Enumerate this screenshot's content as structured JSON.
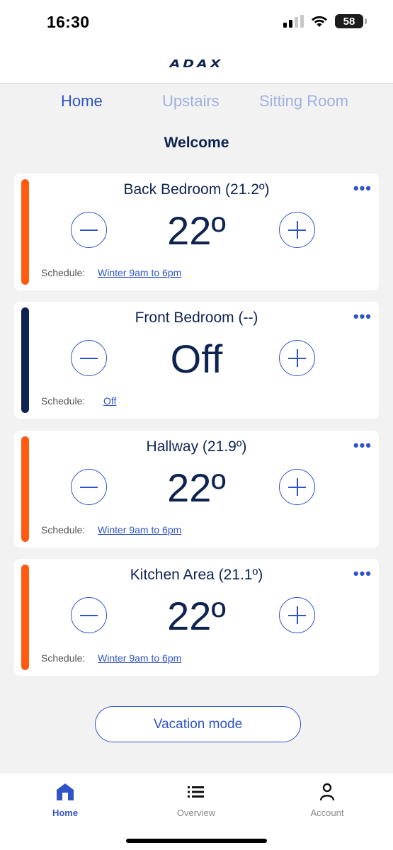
{
  "status": {
    "time": "16:30",
    "battery": "58"
  },
  "header": {
    "logo": "ADAX"
  },
  "tabs": [
    {
      "label": "Home",
      "active": true
    },
    {
      "label": "Upstairs",
      "active": false
    },
    {
      "label": "Sitting Room",
      "active": false
    }
  ],
  "welcome": "Welcome",
  "rooms": [
    {
      "title": "Back Bedroom (21.2º)",
      "setpoint": "22º",
      "schedule_label": "Schedule:",
      "schedule": "Winter 9am to 6pm",
      "bar_color": "#ff5a10"
    },
    {
      "title": "Front Bedroom (--)",
      "setpoint": "Off",
      "schedule_label": "Schedule:",
      "schedule": "Off",
      "bar_color": "#0f2350"
    },
    {
      "title": "Hallway (21.9º)",
      "setpoint": "22º",
      "schedule_label": "Schedule:",
      "schedule": "Winter 9am to 6pm",
      "bar_color": "#ff5a10"
    },
    {
      "title": "Kitchen Area (21.1º)",
      "setpoint": "22º",
      "schedule_label": "Schedule:",
      "schedule": "Winter 9am to 6pm",
      "bar_color": "#ff5a10"
    }
  ],
  "more_icon": "•••",
  "vacation_label": "Vacation mode",
  "nav": [
    {
      "label": "Home",
      "icon": "home-icon",
      "active": true
    },
    {
      "label": "Overview",
      "icon": "list-icon",
      "active": false
    },
    {
      "label": "Account",
      "icon": "person-icon",
      "active": false
    }
  ],
  "colors": {
    "accent": "#2f54c8",
    "heating": "#ff5a10",
    "off": "#0f2350",
    "text": "#0f2350"
  }
}
